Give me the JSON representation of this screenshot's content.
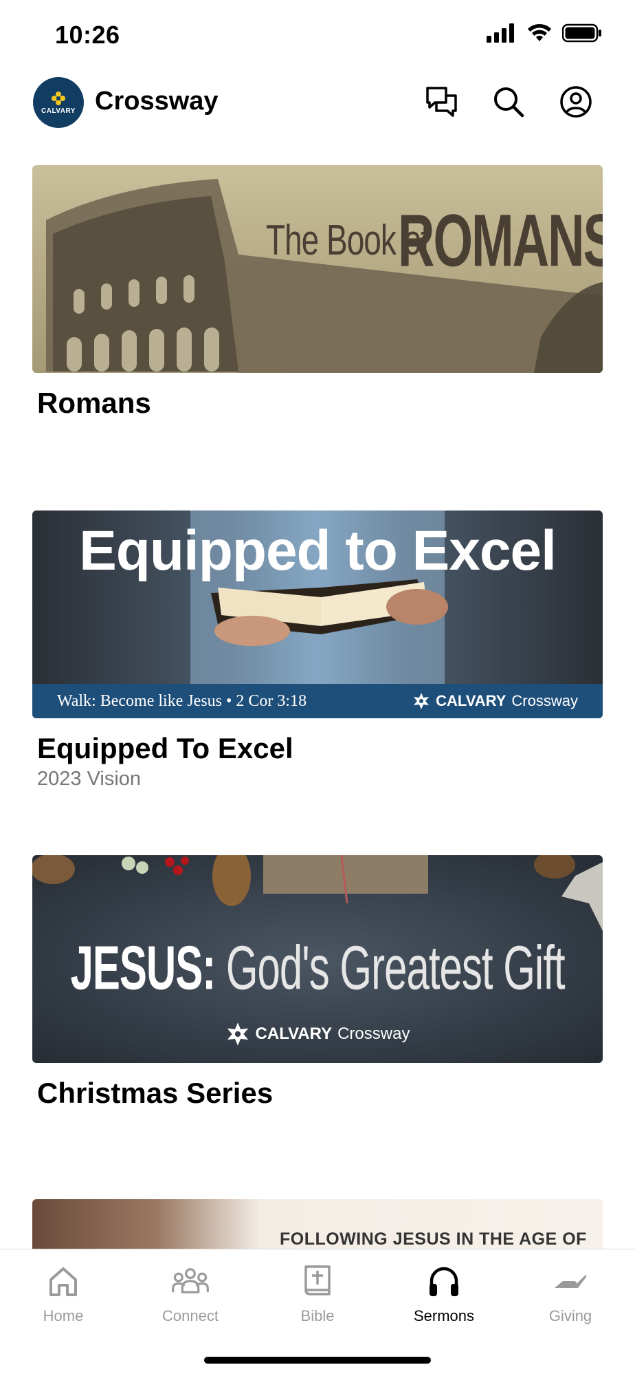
{
  "status_bar": {
    "time": "10:26"
  },
  "header": {
    "logo_text": "CALVARY",
    "title": "Crossway",
    "icons": [
      "chat-icon",
      "search-icon",
      "profile-icon"
    ]
  },
  "series": [
    {
      "banner_line1": "The Book of",
      "banner_line2": "ROMANS",
      "title": "Romans",
      "subtitle": ""
    },
    {
      "banner_title": "Equipped to Excel",
      "banner_walk": "Walk: Become like Jesus • 2 Cor 3:18",
      "banner_brand_bold": "CALVARY",
      "banner_brand_light": "Crossway",
      "title": "Equipped To Excel",
      "subtitle": "2023 Vision"
    },
    {
      "banner_title_bold": "JESUS:",
      "banner_title_light": "God's Greatest Gift",
      "banner_brand_bold": "CALVARY",
      "banner_brand_light": "Crossway",
      "title": "Christmas Series",
      "subtitle": ""
    },
    {
      "banner_text": "FOLLOWING JESUS IN THE AGE OF"
    }
  ],
  "bottom_nav": {
    "items": [
      {
        "label": "Home",
        "icon": "home-icon",
        "active": false
      },
      {
        "label": "Connect",
        "icon": "people-icon",
        "active": false
      },
      {
        "label": "Bible",
        "icon": "bible-icon",
        "active": false
      },
      {
        "label": "Sermons",
        "icon": "headphones-icon",
        "active": true
      },
      {
        "label": "Giving",
        "icon": "giving-hand-icon",
        "active": false
      }
    ]
  },
  "colors": {
    "brand_navy": "#123d63",
    "inactive_nav": "#9a9a9a",
    "active_nav": "#000000"
  }
}
